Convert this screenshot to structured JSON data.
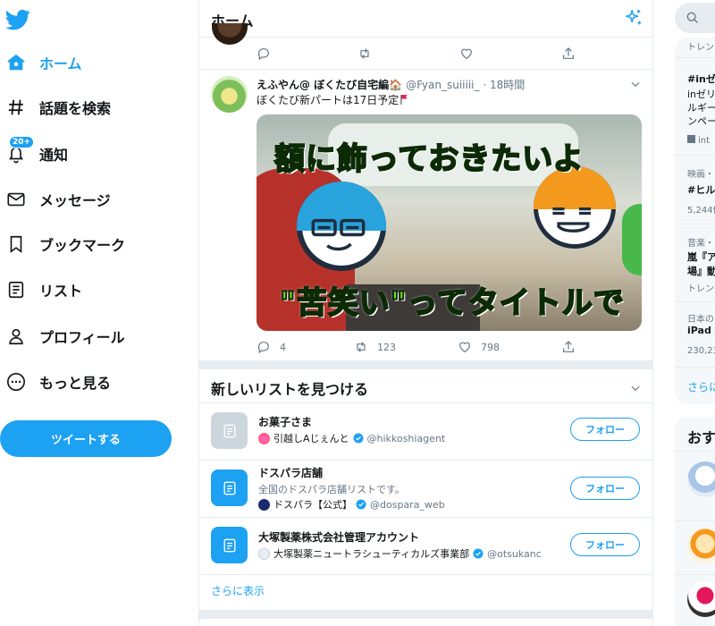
{
  "nav": {
    "items": [
      {
        "label": "ホーム",
        "icon": "home-icon"
      },
      {
        "label": "話題を検索",
        "icon": "hashtag-icon"
      },
      {
        "label": "通知",
        "icon": "bell-icon",
        "badge": "20+"
      },
      {
        "label": "メッセージ",
        "icon": "mail-icon"
      },
      {
        "label": "ブックマーク",
        "icon": "bookmark-icon"
      },
      {
        "label": "リスト",
        "icon": "list-icon"
      },
      {
        "label": "プロフィール",
        "icon": "person-icon"
      },
      {
        "label": "もっと見る",
        "icon": "more-icon"
      }
    ],
    "tweet_button": "ツイートする"
  },
  "header": {
    "title": "ホーム"
  },
  "tweet": {
    "name": "えふやん@ ぼくたび自宅編🏠",
    "handle": "@Fyan_suiiiii_ · 18時間",
    "text": "ぼくたび新パートは17日予定",
    "image": {
      "caption_top": "額に飾っておきたいよ",
      "caption_bottom": "\"苦笑い\"ってタイトルで"
    },
    "replies": "4",
    "retweets": "123",
    "likes": "798"
  },
  "lists_section": {
    "title": "新しいリストを見つける",
    "items": [
      {
        "name": "お菓子さま",
        "description": "",
        "owner": "引越しAじぇんと",
        "owner_handle": "@hikkoshiagent",
        "follow": "フォロー"
      },
      {
        "name": "ドスパラ店舗",
        "description": "全国のドスパラ店舗リストです。",
        "owner": "ドスパラ【公式】",
        "owner_handle": "@dospara_web",
        "follow": "フォロー"
      },
      {
        "name": "大塚製薬株式会社管理アカウント",
        "description": "",
        "owner": "大塚製薬ニュートラシューティカルズ事業部",
        "owner_handle": "@otsukanc",
        "follow": "フォロー"
      }
    ],
    "show_more": "さらに表示"
  },
  "right": {
    "trends_header": "トレン",
    "trends": [
      {
        "line1": "#inゼ",
        "line2": "inゼリ",
        "line3": "ルギー",
        "line4": "ンペー",
        "link": "int"
      },
      {
        "line1": "映画・",
        "line2": "#ヒル",
        "line3": "5,244件"
      },
      {
        "line1": "音楽・",
        "line2": "嵐『ア",
        "line3": "場』動",
        "line4": "トレン"
      },
      {
        "line1": "日本の",
        "line2": "iPad /",
        "line3": "230,23"
      }
    ],
    "trends_more": "さらに",
    "who_title": "おす"
  }
}
